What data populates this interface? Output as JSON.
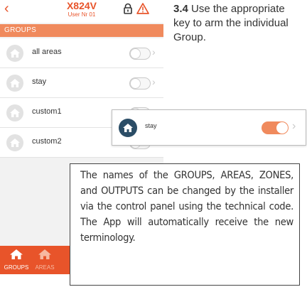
{
  "app": {
    "title": "X824V",
    "subtitle": "User Nr 01",
    "back_icon": "chevron-left-icon",
    "accent": "#e8542a",
    "header_color": "#f08a5d"
  },
  "section": {
    "header": "GROUPS"
  },
  "groups": [
    {
      "label": "all areas",
      "on": false
    },
    {
      "label": "stay",
      "on": false
    },
    {
      "label": "custom1",
      "on": false
    },
    {
      "label": "custom2",
      "on": false
    }
  ],
  "tabs": [
    {
      "label": "GROUPS",
      "active": true
    },
    {
      "label": "AREAS",
      "active": false
    }
  ],
  "instruction": {
    "step": "3.4",
    "text": "Use the appropriate key to arm the individual Group."
  },
  "callout": {
    "label": "stay",
    "on": true,
    "toggle_color": "#f08a5d"
  },
  "note": {
    "text": "The names of the GROUPS, AREAS, ZONES, and OUTPUTS can be changed by the installer via the control panel using the technical code. The App will automatically receive the new terminology."
  }
}
